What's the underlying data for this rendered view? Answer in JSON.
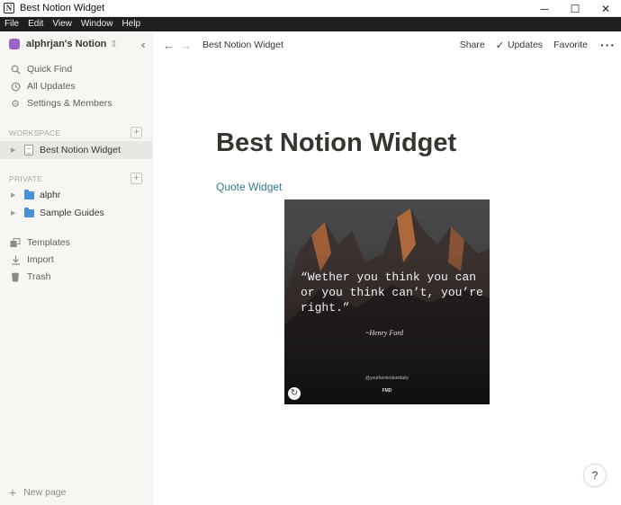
{
  "window": {
    "title": "Best Notion Widget",
    "minimize_symbol": "─",
    "maximize_symbol": "☐",
    "close_symbol": "✕"
  },
  "menu": [
    "File",
    "Edit",
    "View",
    "Window",
    "Help"
  ],
  "sidebar": {
    "workspace_name": "alphrjan's Notion",
    "workspace_color": "#9a62c4",
    "nav": [
      {
        "label": "Quick Find",
        "icon": "search-icon"
      },
      {
        "label": "All Updates",
        "icon": "clock-icon"
      },
      {
        "label": "Settings & Members",
        "icon": "gear-icon"
      }
    ],
    "workspace_label": "WORKSPACE",
    "workspace_pages": [
      {
        "label": "Best Notion Widget",
        "icon": "document-icon",
        "active": true
      }
    ],
    "private_label": "PRIVATE",
    "private_pages": [
      {
        "label": "alphr",
        "icon": "folder-icon"
      },
      {
        "label": "Sample Guides",
        "icon": "folder-icon"
      }
    ],
    "tools": [
      {
        "label": "Templates",
        "icon": "templates-icon"
      },
      {
        "label": "Import",
        "icon": "download-icon"
      },
      {
        "label": "Trash",
        "icon": "trash-icon"
      }
    ],
    "new_page_label": "New page"
  },
  "topbar": {
    "breadcrumb": "Best Notion Widget",
    "share": "Share",
    "updates": "Updates",
    "favorite": "Favorite"
  },
  "page": {
    "title": "Best Notion Widget",
    "link_text": "Quote Widget",
    "link_color": "#2f7e89",
    "widget": {
      "quote": "“Wether you think you can or you think can’t, you’re right.”",
      "author": "~Henry Ford",
      "handle": "@youthemindsetdaily",
      "brand": "FMD"
    }
  },
  "help_label": "?"
}
